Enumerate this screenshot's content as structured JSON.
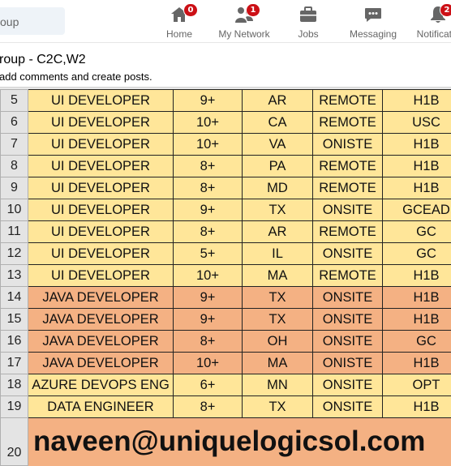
{
  "nav": {
    "search_placeholder": "oup",
    "items": [
      {
        "label": "Home",
        "icon": "home-icon",
        "badge": "0"
      },
      {
        "label": "My Network",
        "icon": "network-icon",
        "badge": "1"
      },
      {
        "label": "Jobs",
        "icon": "briefcase-icon",
        "badge": ""
      },
      {
        "label": "Messaging",
        "icon": "chat-icon",
        "badge": ""
      },
      {
        "label": "Notificatio",
        "icon": "bell-icon",
        "badge": "2"
      }
    ]
  },
  "group": {
    "title": "roup - C2C,W2",
    "subtitle": "add comments and create posts."
  },
  "sheet": {
    "rows": [
      {
        "num": "5",
        "role": "UI DEVELOPER",
        "exp": "9+",
        "state": "AR",
        "mode": "REMOTE",
        "visa": "H1B"
      },
      {
        "num": "6",
        "role": "UI DEVELOPER",
        "exp": "10+",
        "state": "CA",
        "mode": "REMOTE",
        "visa": "USC"
      },
      {
        "num": "7",
        "role": "UI DEVELOPER",
        "exp": "10+",
        "state": "VA",
        "mode": "ONISTE",
        "visa": "H1B"
      },
      {
        "num": "8",
        "role": "UI DEVELOPER",
        "exp": "8+",
        "state": "PA",
        "mode": "REMOTE",
        "visa": "H1B"
      },
      {
        "num": "9",
        "role": "UI DEVELOPER",
        "exp": "8+",
        "state": "MD",
        "mode": "REMOTE",
        "visa": "H1B"
      },
      {
        "num": "10",
        "role": "UI DEVELOPER",
        "exp": "9+",
        "state": "TX",
        "mode": "ONSITE",
        "visa": "GCEAD"
      },
      {
        "num": "11",
        "role": "UI DEVELOPER",
        "exp": "8+",
        "state": "AR",
        "mode": "REMOTE",
        "visa": "GC"
      },
      {
        "num": "12",
        "role": "UI DEVELOPER",
        "exp": "5+",
        "state": "IL",
        "mode": "ONSITE",
        "visa": "GC"
      },
      {
        "num": "13",
        "role": "UI DEVELOPER",
        "exp": "10+",
        "state": "MA",
        "mode": "REMOTE",
        "visa": "H1B"
      },
      {
        "num": "14",
        "role": "JAVA DEVELOPER",
        "exp": "9+",
        "state": "TX",
        "mode": "ONSITE",
        "visa": "H1B"
      },
      {
        "num": "15",
        "role": "JAVA DEVELOPER",
        "exp": "9+",
        "state": "TX",
        "mode": "ONSITE",
        "visa": "H1B"
      },
      {
        "num": "16",
        "role": "JAVA DEVELOPER",
        "exp": "8+",
        "state": "OH",
        "mode": "ONSITE",
        "visa": "GC"
      },
      {
        "num": "17",
        "role": "JAVA DEVELOPER",
        "exp": "10+",
        "state": "MA",
        "mode": "ONISTE",
        "visa": "H1B"
      },
      {
        "num": "18",
        "role": "AZURE DEVOPS ENG",
        "exp": "6+",
        "state": "MN",
        "mode": "ONSITE",
        "visa": "OPT"
      },
      {
        "num": "19",
        "role": "DATA ENGINEER",
        "exp": "8+",
        "state": "TX",
        "mode": "ONSITE",
        "visa": "H1B"
      }
    ],
    "email_row": {
      "num": "20",
      "email": "naveen@uniquelogicsol.com"
    }
  },
  "colors": {
    "ui_row": "#ffe699",
    "java_row": "#f4b183",
    "badge": "#cc1016"
  }
}
